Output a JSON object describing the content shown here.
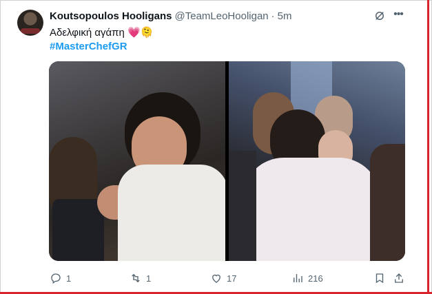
{
  "tweet": {
    "display_name": "Koutsopoulos Hooligans",
    "handle": "@TeamLeoHooligan",
    "separator": "·",
    "time": "5m",
    "text": "Αδελφική αγάπη 💗🫠",
    "hashtag": "#MasterChefGR"
  },
  "actions": {
    "replies": "1",
    "retweets": "1",
    "likes": "17",
    "views": "216"
  },
  "icons": [
    "grok-icon",
    "more-icon",
    "reply-icon",
    "retweet-icon",
    "like-icon",
    "views-icon",
    "bookmark-icon",
    "share-icon"
  ],
  "colors": {
    "link": "#1d9bf0",
    "secondary_text": "#536471",
    "frame_accent": "#d9232d"
  }
}
